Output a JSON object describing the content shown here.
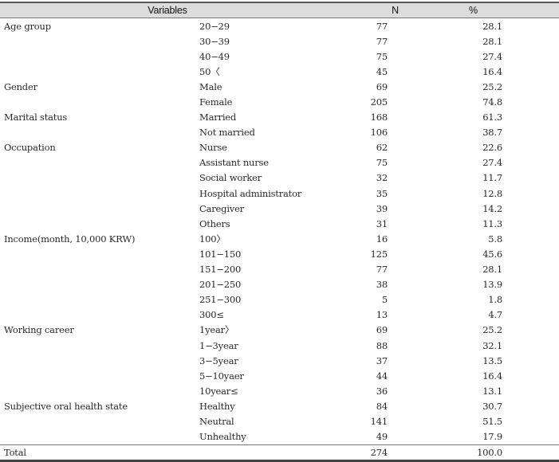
{
  "table": {
    "headers": {
      "variables": "Variables",
      "n": "N",
      "pct": "%"
    },
    "groups": [
      {
        "variable": "Age group",
        "rows": [
          {
            "category": "20−29",
            "n": "77",
            "pct": "28.1"
          },
          {
            "category": "30−39",
            "n": "77",
            "pct": "28.1"
          },
          {
            "category": "40−49",
            "n": "75",
            "pct": "27.4"
          },
          {
            "category": "50〈",
            "n": "45",
            "pct": "16.4"
          }
        ]
      },
      {
        "variable": "Gender",
        "rows": [
          {
            "category": "Male",
            "n": "69",
            "pct": "25.2"
          },
          {
            "category": "Female",
            "n": "205",
            "pct": "74.8"
          }
        ]
      },
      {
        "variable": "Marital status",
        "rows": [
          {
            "category": "Married",
            "n": "168",
            "pct": "61.3"
          },
          {
            "category": "Not married",
            "n": "106",
            "pct": "38.7"
          }
        ]
      },
      {
        "variable": "Occupation",
        "rows": [
          {
            "category": "Nurse",
            "n": "62",
            "pct": "22.6"
          },
          {
            "category": "Assistant nurse",
            "n": "75",
            "pct": "27.4"
          },
          {
            "category": "Social worker",
            "n": "32",
            "pct": "11.7"
          },
          {
            "category": "Hospital administrator",
            "n": "35",
            "pct": "12.8"
          },
          {
            "category": "Caregiver",
            "n": "39",
            "pct": "14.2"
          },
          {
            "category": "Others",
            "n": "31",
            "pct": "11.3"
          }
        ]
      },
      {
        "variable": "Income(month, 10,000 KRW)",
        "rows": [
          {
            "category": "100〉",
            "n": "16",
            "pct": "5.8"
          },
          {
            "category": "101−150",
            "n": "125",
            "pct": "45.6"
          },
          {
            "category": "151−200",
            "n": "77",
            "pct": "28.1"
          },
          {
            "category": "201−250",
            "n": "38",
            "pct": "13.9"
          },
          {
            "category": "251−300",
            "n": "5",
            "pct": "1.8"
          },
          {
            "category": "300≤",
            "n": "13",
            "pct": "4.7"
          }
        ]
      },
      {
        "variable": "Working career",
        "rows": [
          {
            "category": "1year〉",
            "n": "69",
            "pct": "25.2"
          },
          {
            "category": "1−3year",
            "n": "88",
            "pct": "32.1"
          },
          {
            "category": "3−5year",
            "n": "37",
            "pct": "13.5"
          },
          {
            "category": "5−10yaer",
            "n": "44",
            "pct": "16.4"
          },
          {
            "category": "10year≤",
            "n": "36",
            "pct": "13.1"
          }
        ]
      },
      {
        "variable": "Subjective oral health state",
        "rows": [
          {
            "category": "Healthy",
            "n": "84",
            "pct": "30.7"
          },
          {
            "category": "Neutral",
            "n": "141",
            "pct": "51.5"
          },
          {
            "category": "Unhealthy",
            "n": "49",
            "pct": "17.9"
          }
        ]
      }
    ],
    "total": {
      "label": "Total",
      "n": "274",
      "pct": "100.0"
    }
  }
}
